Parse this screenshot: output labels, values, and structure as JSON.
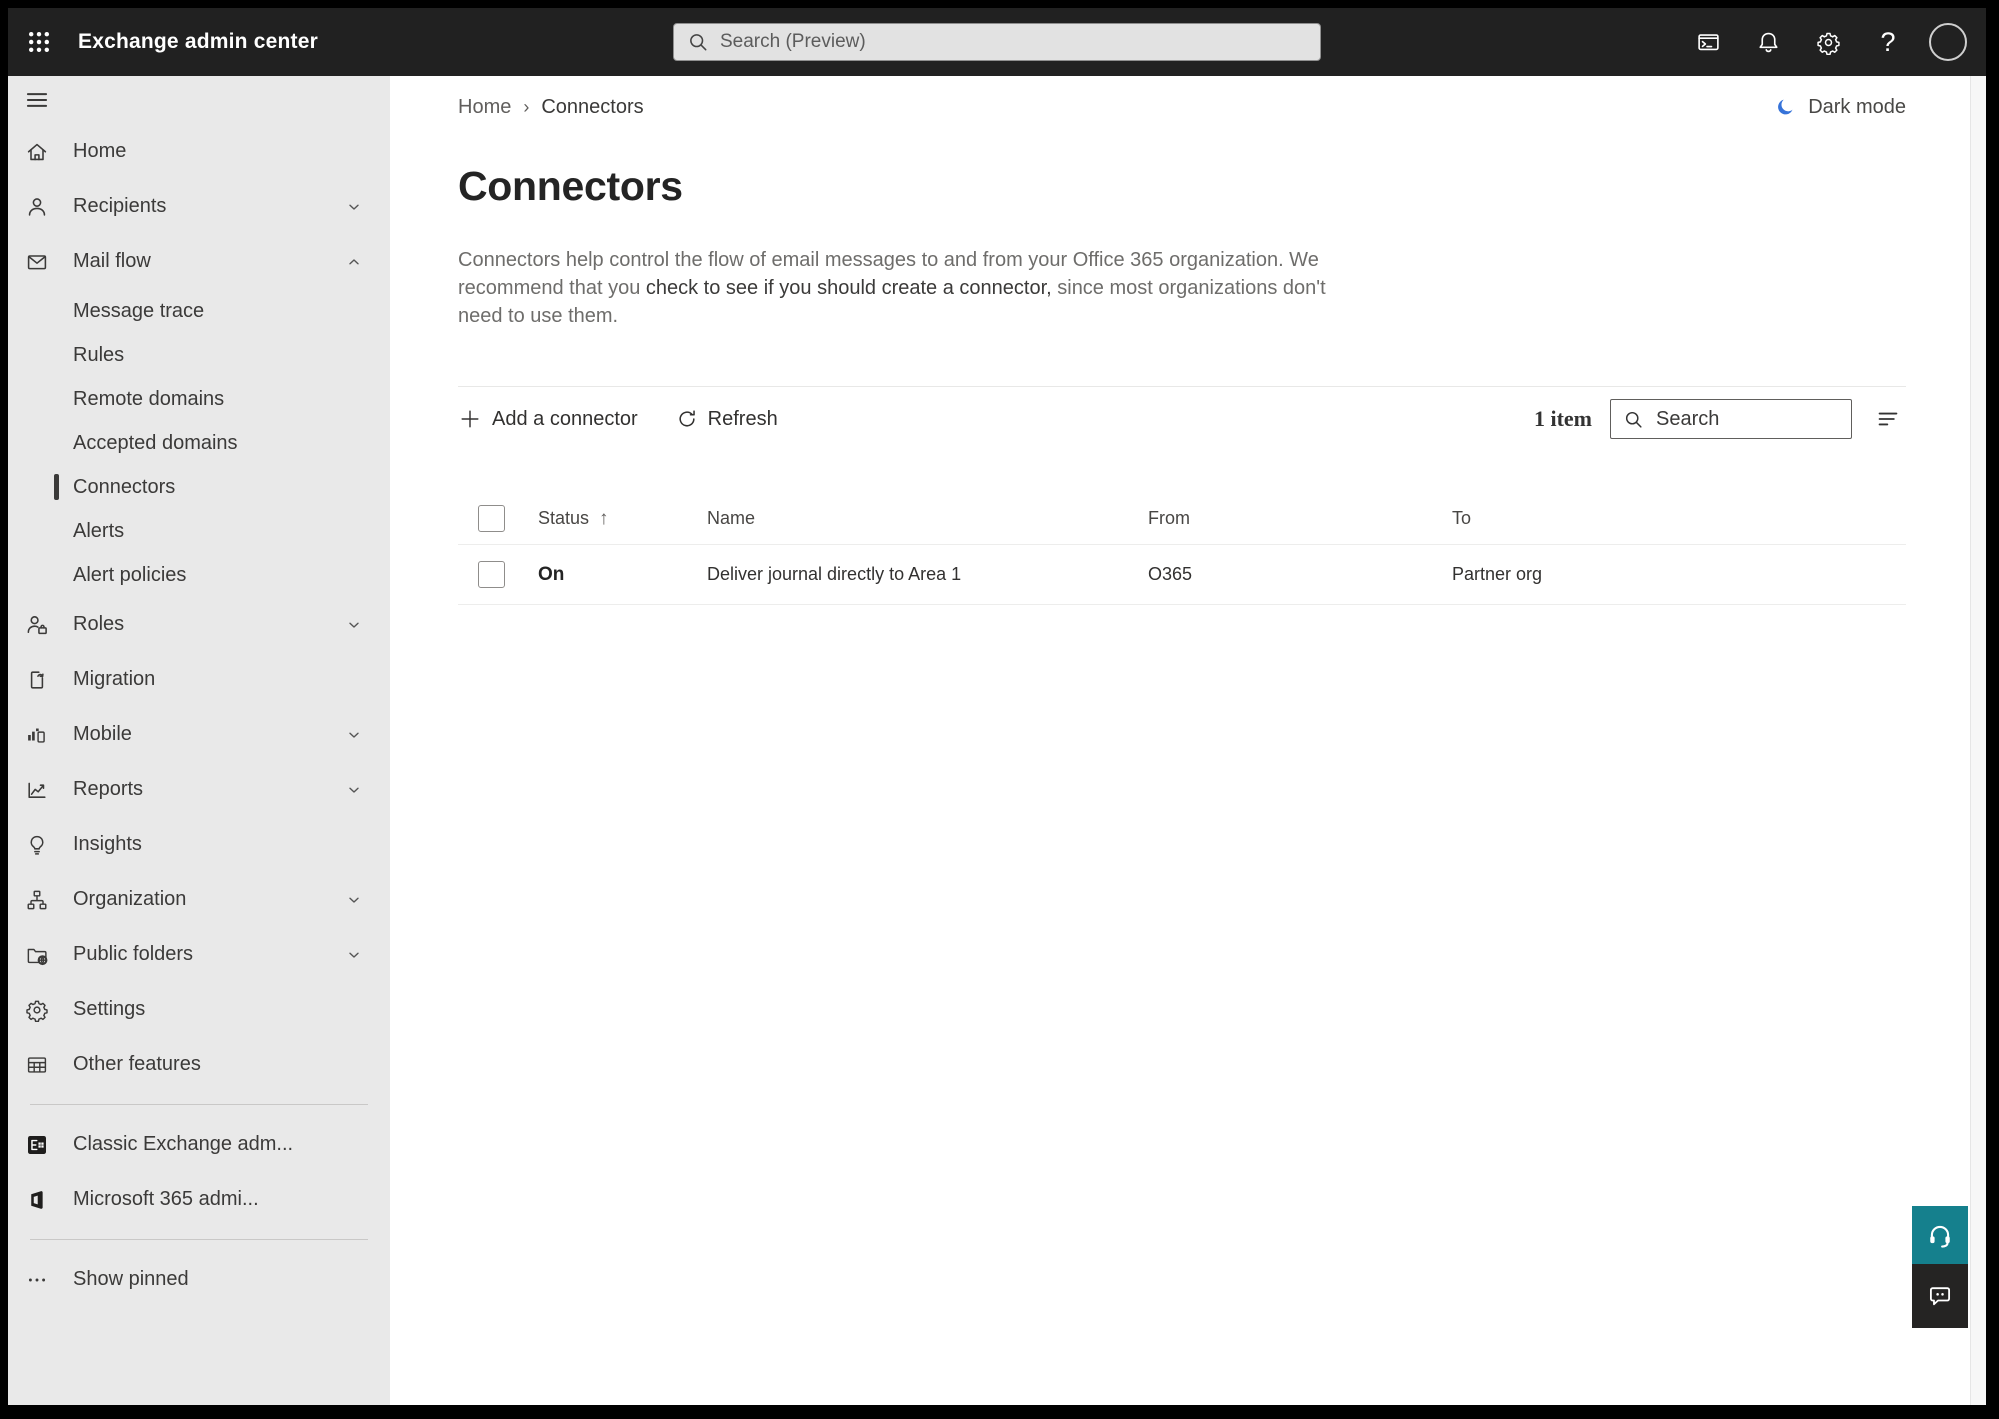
{
  "topbar": {
    "app_title": "Exchange admin center",
    "search_placeholder": "Search (Preview)"
  },
  "sidebar": {
    "home": "Home",
    "recipients": "Recipients",
    "mail_flow": "Mail flow",
    "message_trace": "Message trace",
    "rules": "Rules",
    "remote_domains": "Remote domains",
    "accepted_domains": "Accepted domains",
    "connectors": "Connectors",
    "alerts": "Alerts",
    "alert_policies": "Alert policies",
    "roles": "Roles",
    "migration": "Migration",
    "mobile": "Mobile",
    "reports": "Reports",
    "insights": "Insights",
    "organization": "Organization",
    "public_folders": "Public folders",
    "settings": "Settings",
    "other_features": "Other features",
    "classic_exchange": "Classic Exchange adm...",
    "m365_admin": "Microsoft 365 admi...",
    "show_pinned": "Show pinned"
  },
  "breadcrumb": {
    "home": "Home",
    "separator": "›",
    "current": "Connectors"
  },
  "header": {
    "dark_mode": "Dark mode",
    "title": "Connectors",
    "desc_pre": "Connectors help control the flow of email messages to and from your Office 365 organization. We recommend that you ",
    "desc_link": "check to see if you should create a connector,",
    "desc_post": " since most organizations don't need to use them."
  },
  "toolbar": {
    "add_connector": "Add a connector",
    "refresh": "Refresh",
    "item_count": "1 item",
    "search_placeholder": "Search"
  },
  "table": {
    "headers": {
      "status": "Status",
      "name": "Name",
      "from": "From",
      "to": "To"
    },
    "sort_icon": "↑",
    "rows": [
      {
        "status": "On",
        "name": "Deliver journal directly to Area 1",
        "from": "O365",
        "to": "Partner org"
      }
    ]
  },
  "colors": {
    "topbar_bg": "#212121",
    "sidebar_bg": "#e9e9e9",
    "accent_blue": "#3673d9",
    "support_teal": "#15808d"
  }
}
